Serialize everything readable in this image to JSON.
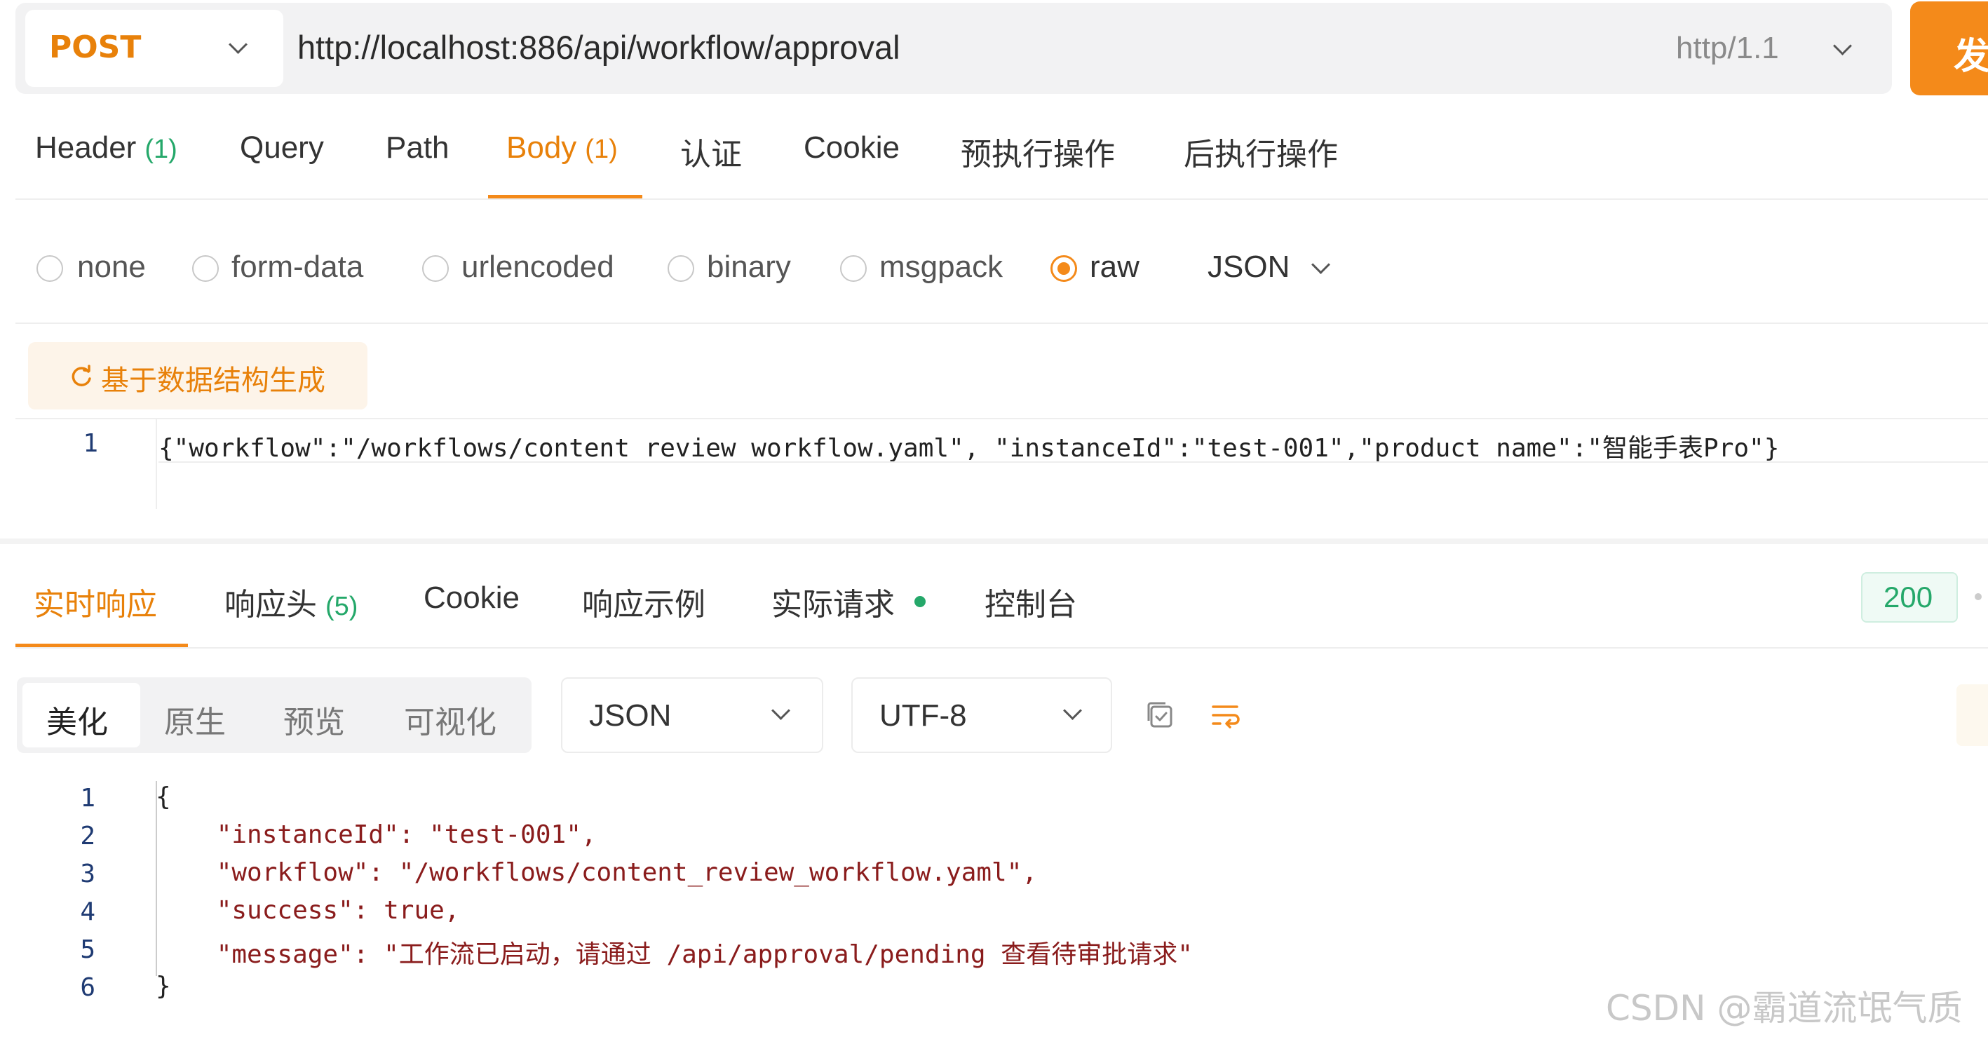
{
  "request": {
    "method": "POST",
    "url": "http://localhost:886/api/workflow/approval",
    "protocol": "http/1.1",
    "send_label": "发"
  },
  "request_tabs": [
    {
      "label": "Header",
      "count": "(1)"
    },
    {
      "label": "Query",
      "count": ""
    },
    {
      "label": "Path",
      "count": ""
    },
    {
      "label": "Body",
      "count": "(1)"
    },
    {
      "label": "认证",
      "count": ""
    },
    {
      "label": "Cookie",
      "count": ""
    },
    {
      "label": "预执行操作",
      "count": ""
    },
    {
      "label": "后执行操作",
      "count": ""
    }
  ],
  "active_request_tab": "Body",
  "body_types": [
    "none",
    "form-data",
    "urlencoded",
    "binary",
    "msgpack",
    "raw"
  ],
  "selected_body_type": "raw",
  "body_format": "JSON",
  "generate_button": "基于数据结构生成",
  "request_body": {
    "line_number": "1",
    "text": "{\"workflow\":\"/workflows/content_review_workflow.yaml\", \"instanceId\":\"test-001\",\"product_name\":\"智能手表Pro\"}"
  },
  "response_tabs": [
    {
      "label": "实时响应",
      "count": ""
    },
    {
      "label": "响应头",
      "count": "(5)"
    },
    {
      "label": "Cookie",
      "count": ""
    },
    {
      "label": "响应示例",
      "count": ""
    },
    {
      "label": "实际请求",
      "count": ""
    },
    {
      "label": "控制台",
      "count": ""
    }
  ],
  "active_response_tab": "实时响应",
  "status_code": "200",
  "view_modes": [
    "美化",
    "原生",
    "预览",
    "可视化"
  ],
  "active_view_mode": "美化",
  "response_format": "JSON",
  "encoding": "UTF-8",
  "response_lines": [
    {
      "no": "1",
      "text": "{"
    },
    {
      "no": "2",
      "text": "    \"instanceId\": \"test-001\","
    },
    {
      "no": "3",
      "text": "    \"workflow\": \"/workflows/content_review_workflow.yaml\","
    },
    {
      "no": "4",
      "text": "    \"success\": true,"
    },
    {
      "no": "5",
      "text": "    \"message\": \"工作流已启动，请通过 /api/approval/pending 查看待审批请求\""
    },
    {
      "no": "6",
      "text": "}"
    }
  ],
  "watermark": "CSDN @霸道流氓气质",
  "colors": {
    "accent": "#f48a1a",
    "accent_text": "#e8810a",
    "success": "#25a86a"
  }
}
